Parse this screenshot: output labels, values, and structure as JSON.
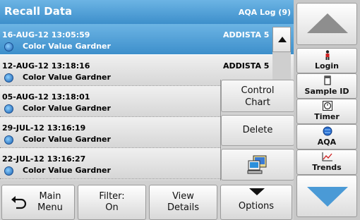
{
  "header": {
    "title": "Recall Data",
    "log": "AQA Log (9)"
  },
  "rows": [
    {
      "date": "16-AUG-12  13:05:59",
      "device": "ADDISTA 5",
      "param": "Color Value Gardner",
      "selected": true
    },
    {
      "date": "12-AUG-12  13:18:16",
      "device": "ADDISTA 5",
      "param": "Color Value Gardner",
      "selected": false
    },
    {
      "date": "05-AUG-12  13:18:01",
      "device": "",
      "param": "Color Value Gardner",
      "selected": false
    },
    {
      "date": "29-JUL-12  13:16:19",
      "device": "",
      "param": "Color Value Gardner",
      "selected": false
    },
    {
      "date": "22-JUL-12  13:16:27",
      "device": "",
      "param": "Color Value Gardner",
      "selected": false
    }
  ],
  "popup": {
    "control_line1": "Control",
    "control_line2": "Chart",
    "delete": "Delete",
    "export_icon": "computer-export-icon"
  },
  "bottom": {
    "main_line1": "Main",
    "main_line2": "Menu",
    "filter_line1": "Filter:",
    "filter_line2": "On",
    "view_line1": "View",
    "view_line2": "Details",
    "options": "Options"
  },
  "sidebar": {
    "login": "Login",
    "sample_id": "Sample ID",
    "timer": "Timer",
    "aqa": "AQA",
    "trends": "Trends"
  },
  "colors": {
    "accent": "#4a9ad6",
    "selected_row": "#5aa6dd"
  }
}
